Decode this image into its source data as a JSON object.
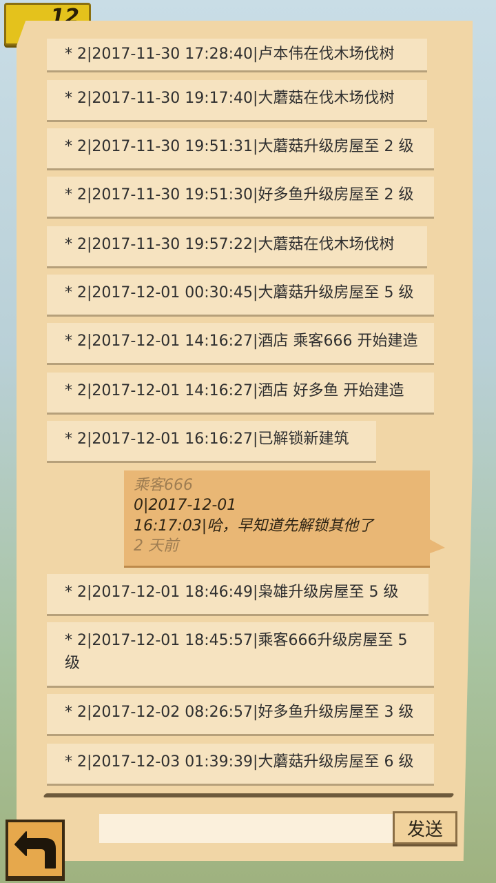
{
  "header": {
    "badge_number": "12"
  },
  "log_entries": [
    {
      "text": "* 2|2017-11-30 17:28:40|卢本伟在伐木场伐树"
    },
    {
      "text": "* 2|2017-11-30 19:17:40|大蘑菇在伐木场伐树"
    },
    {
      "text": "* 2|2017-11-30 19:51:31|大蘑菇升级房屋至 2 级"
    },
    {
      "text": "* 2|2017-11-30 19:51:30|好多鱼升级房屋至 2 级"
    },
    {
      "text": "* 2|2017-11-30 19:57:22|大蘑菇在伐木场伐树"
    },
    {
      "text": "* 2|2017-12-01 00:30:45|大蘑菇升级房屋至 5 级"
    },
    {
      "text": "* 2|2017-12-01 14:16:27|酒店 乘客666 开始建造"
    },
    {
      "text": "* 2|2017-12-01 14:16:27|酒店 好多鱼 开始建造"
    },
    {
      "text": "* 2|2017-12-01 16:16:27|已解锁新建筑"
    },
    {
      "text": "* 2|2017-12-01 18:46:49|枭雄升级房屋至 5 级"
    },
    {
      "text": "* 2|2017-12-01 18:45:57|乘客666升级房屋至 5 级"
    },
    {
      "text": "* 2|2017-12-02 08:26:57|好多鱼升级房屋至 3 级"
    },
    {
      "text": "* 2|2017-12-03 01:39:39|大蘑菇升级房屋至 6 级"
    }
  ],
  "chat_message": {
    "user": "乘客666",
    "line1": "0|2017-12-01",
    "line2": "16:17:03|哈，早知道先解锁其他了",
    "time_ago": "2 天前"
  },
  "footer": {
    "input_value": "",
    "input_placeholder": "",
    "send_label": "发送",
    "back_icon": "back-arrow-icon"
  },
  "colors": {
    "panel": "#f1d6a6",
    "entry": "#f6e3c0",
    "bubble": "#e9b775",
    "button_back": "#e6a84c"
  }
}
